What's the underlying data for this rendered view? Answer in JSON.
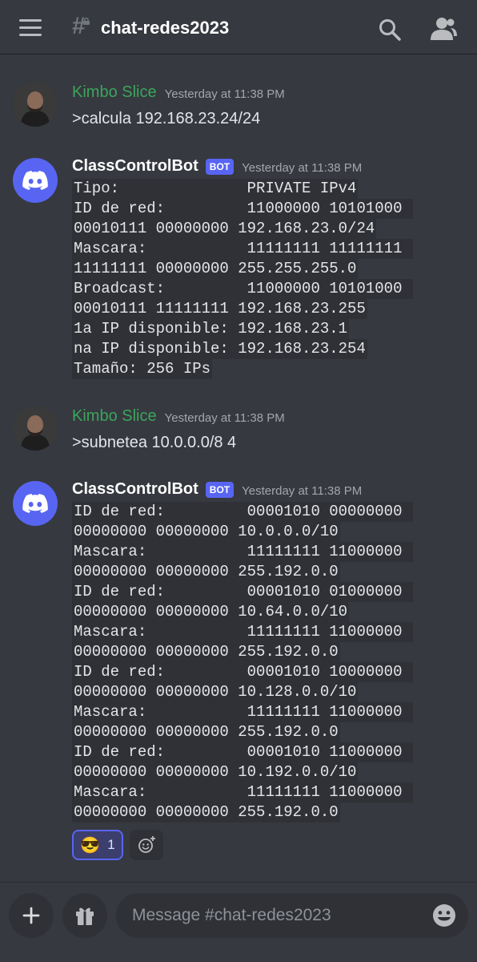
{
  "header": {
    "channel_name": "chat-redes2023"
  },
  "messages": [
    {
      "author": "Kimbo Slice",
      "timestamp": "Yesterday at 11:38 PM",
      "text": ">calcula  192.168.23.24/24"
    },
    {
      "author": "ClassControlBot",
      "bot_tag": "BOT",
      "timestamp": "Yesterday at 11:38 PM",
      "lines": [
        "Tipo:              PRIVATE IPv4",
        "ID de red:         11000000 10101000 ",
        "00010111 00000000 192.168.23.0/24",
        "Mascara:           11111111 11111111 ",
        "11111111 00000000 255.255.255.0",
        "Broadcast:         11000000 10101000 ",
        "00010111 11111111 192.168.23.255",
        "1a IP disponible: 192.168.23.1",
        "na IP disponible: 192.168.23.254",
        "Tamaño: 256 IPs"
      ]
    },
    {
      "author": "Kimbo Slice",
      "timestamp": "Yesterday at 11:38 PM",
      "text": ">subnetea 10.0.0.0/8 4"
    },
    {
      "author": "ClassControlBot",
      "bot_tag": "BOT",
      "timestamp": "Yesterday at 11:38 PM",
      "lines": [
        "ID de red:         00001010 00000000 ",
        "00000000 00000000 10.0.0.0/10",
        "Mascara:           11111111 11000000 ",
        "00000000 00000000 255.192.0.0",
        "ID de red:         00001010 01000000 ",
        "00000000 00000000 10.64.0.0/10",
        "Mascara:           11111111 11000000 ",
        "00000000 00000000 255.192.0.0",
        "ID de red:         00001010 10000000 ",
        "00000000 00000000 10.128.0.0/10",
        "Mascara:           11111111 11000000 ",
        "00000000 00000000 255.192.0.0",
        "ID de red:         00001010 11000000 ",
        "00000000 00000000 10.192.0.0/10",
        "Mascara:           11111111 11000000 ",
        "00000000 00000000 255.192.0.0"
      ],
      "reaction": {
        "emoji": "😎",
        "count": "1"
      }
    }
  ],
  "composer": {
    "placeholder": "Message #chat-redes2023"
  },
  "colors": {
    "background": "#36393f",
    "blurple": "#5865f2",
    "user_name": "#3ba55c",
    "code_bg": "#2f3136"
  },
  "icons": {
    "menu": "hamburger-icon",
    "channel": "text-channel-locked-icon",
    "search": "search-icon",
    "members": "members-icon",
    "add": "plus-icon",
    "gift": "gift-icon",
    "emoji": "emoji-icon",
    "add_reaction": "add-reaction-icon",
    "bot_avatar": "discord-logo-icon"
  }
}
